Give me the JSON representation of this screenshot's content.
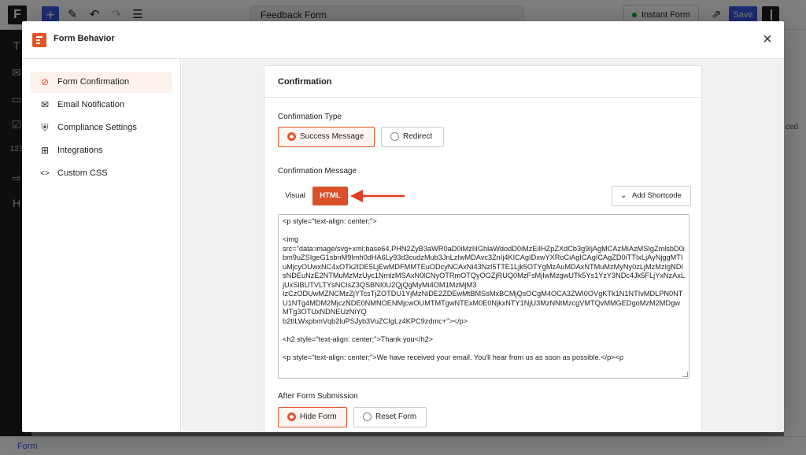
{
  "editor": {
    "logo_letter": "F",
    "add_icon": "+",
    "document_title": "Feedback Form",
    "instant_form_label": "Instant Form",
    "save_label": "Save",
    "rail_icons": [
      "T",
      "✉",
      "▭",
      "☑",
      "123",
      "⇨",
      "H"
    ],
    "right_panel_text": "ced",
    "bottom_label": "Form"
  },
  "modal": {
    "title": "Form Behavior",
    "close_icon": "×",
    "nav": [
      {
        "label": "Form Confirmation",
        "icon": "check-circle-icon",
        "glyph": "⊘",
        "active": true
      },
      {
        "label": "Email Notification",
        "icon": "envelope-icon",
        "glyph": "✉",
        "active": false
      },
      {
        "label": "Compliance Settings",
        "icon": "shield-icon",
        "glyph": "⛨",
        "active": false
      },
      {
        "label": "Integrations",
        "icon": "integrations-icon",
        "glyph": "⊞",
        "active": false
      },
      {
        "label": "Custom CSS",
        "icon": "code-icon",
        "glyph": "<>",
        "active": false
      }
    ]
  },
  "confirmation": {
    "heading": "Confirmation",
    "type_label": "Confirmation Type",
    "type_options": [
      {
        "label": "Success Message",
        "selected": true
      },
      {
        "label": "Redirect",
        "selected": false
      }
    ],
    "message_label": "Confirmation Message",
    "mode_visual": "Visual",
    "mode_html": "HTML",
    "add_shortcode_label": "Add Shortcode",
    "code_lines": [
      "<p style=\"text-align: center;\">",
      "",
      "<img",
      "src=\"data:image/svg+xml;base64,PHN2ZyB3aWR0aD0iMzIiIGhlaWdodD0iMzEiIHZpZXdCb3g9IjAgMCAzMiAzMSIgZmlsbD0ibm9uZSIgeG1sbnM9Imh0dHA6Ly93d3cudzMub3JnLzIwMDAvc3ZnIj4KICAgIDxwYXRoCiAgICAgICAgZD0iTTIxLjAyNjggMTIuMjcyOUwxNC4xOTk2IDE5LjEwMDFMMTEuODcyNCAxNi43NzI5TTE1Ljk5OTYgMzAuMDAxNTMuMzMyNy0zLjMzMzIgNDIsNDEuNzE2NTMuMzMzUyc1NmlzMSAxN0lCNyOTRmOTQyOGZjRUQ0MzFsMjIwMzgwUTk5Ys1YzY3NDc4Jk5FLjYxNzAxLjUxSlBUTVLTYsNCIsZ3QSBNI0U2QjQgMyMi4OM1MzMjM3",
      "IzCzODUwMZNCMzZjYTcsTjZOTDU1YjMzNiDE2ZDEwMtBMSsMxBCMjQsOCgM4OCA3ZWI0OVgKTk1N1NTIvMDLPN0NTU1NTg4MDM2MjczNDE0NMNOENMjcwOUMTMTgwNTExM0E0NjkxNTY1NjU3MzNNtMzcgVMTQvMMGEDgoMzM2MDgwMTg3OTUxNDNEUzNiYQ",
      "b2tILWxpbmVqb2luPSJyb3VuZCIgLz4KPC9zdmc+\"></p>",
      "",
      "<h2 style=\"text-align: center;\">Thank you</h2>",
      "",
      "<p style=\"text-align: center;\">We have received your email. You'll hear from us as soon as possible.</p><p"
    ],
    "after_label": "After Form Submission",
    "after_options": [
      {
        "label": "Hide Form",
        "selected": true
      },
      {
        "label": "Reset Form",
        "selected": false
      }
    ]
  },
  "colors": {
    "accent": "#e35424",
    "html_tab": "#d9502a",
    "arrow": "#e03d25",
    "wp_blue": "#3858e9"
  }
}
